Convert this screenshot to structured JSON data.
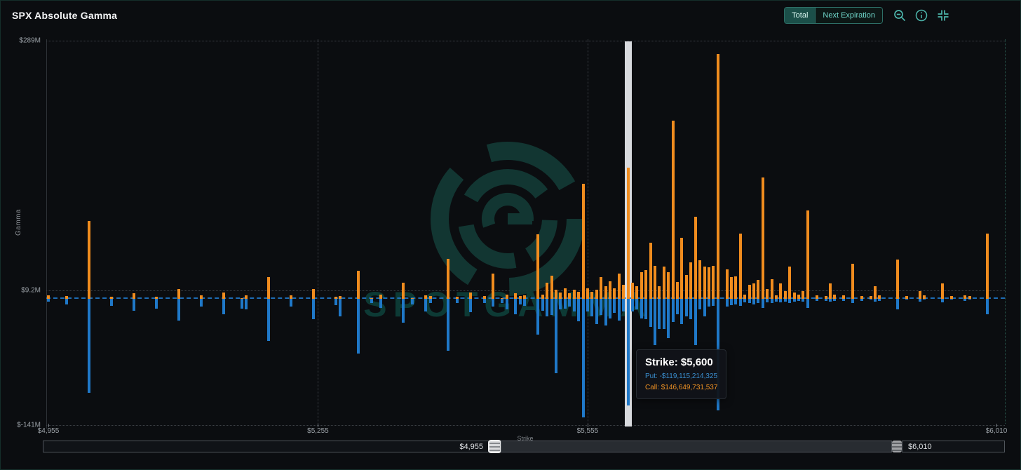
{
  "header": {
    "title": "SPX Absolute Gamma",
    "buttons": [
      {
        "label": "Total",
        "selected": true
      },
      {
        "label": "Next Expiration",
        "selected": false
      }
    ],
    "icons": [
      "zoom-out-icon",
      "info-icon",
      "collapse-icon"
    ],
    "accent_color": "#4db6ac"
  },
  "watermark": {
    "text": "SPOTGAMMA"
  },
  "tooltip": {
    "title": "Strike: $5,600",
    "put": "Put: -$119,115,214,325",
    "call": "Call: $146,649,731,537"
  },
  "slider": {
    "left_value": "$4,955",
    "right_value": "$6,010"
  },
  "chart_data": {
    "type": "bar",
    "title": "SPX Absolute Gamma",
    "xlabel": "Strike",
    "ylabel": "Gamma",
    "grid": "dotted",
    "xlim": [
      4955,
      6010
    ],
    "ylim_m": [
      -141,
      289
    ],
    "x_ticks": [
      {
        "label": "$4,955",
        "value": 4955
      },
      {
        "label": "$5,255",
        "value": 5255
      },
      {
        "label": "$5,555",
        "value": 5555
      },
      {
        "label": "$6,010",
        "value": 6010
      }
    ],
    "y_ticks": [
      {
        "label": "$289M",
        "value_m": 289
      },
      {
        "label": "$9.2M",
        "value_m": 9.2
      },
      {
        "label": "$-141M",
        "value_m": -141
      }
    ],
    "series": [
      {
        "name": "Call",
        "color": "#f08c1e"
      },
      {
        "name": "Put",
        "color": "#1f78c8"
      }
    ],
    "highlighted_strike": 5600,
    "highlight_color": "#d8dade",
    "zero_line_color": "#1f78c8",
    "strikes_format": "[strike, call_gamma_$M, put_gamma_$M]",
    "strikes": [
      [
        4955,
        4,
        -3
      ],
      [
        4975,
        3,
        -6
      ],
      [
        5000,
        87,
        -105
      ],
      [
        5025,
        2,
        -8
      ],
      [
        5050,
        6,
        -13
      ],
      [
        5075,
        2,
        -11
      ],
      [
        5100,
        11,
        -24
      ],
      [
        5125,
        4,
        -9
      ],
      [
        5150,
        7,
        -17
      ],
      [
        5170,
        1,
        -11
      ],
      [
        5175,
        4,
        -12
      ],
      [
        5200,
        24,
        -47
      ],
      [
        5225,
        4,
        -9
      ],
      [
        5250,
        11,
        -23
      ],
      [
        5275,
        2,
        -7
      ],
      [
        5280,
        3,
        -20
      ],
      [
        5300,
        31,
        -61
      ],
      [
        5315,
        1,
        -5
      ],
      [
        5325,
        5,
        -10
      ],
      [
        5350,
        18,
        -27
      ],
      [
        5360,
        1,
        -6
      ],
      [
        5375,
        4,
        -14
      ],
      [
        5380,
        3,
        -5
      ],
      [
        5400,
        45,
        -58
      ],
      [
        5410,
        2,
        -5
      ],
      [
        5425,
        7,
        -15
      ],
      [
        5440,
        3,
        -5
      ],
      [
        5450,
        28,
        -9
      ],
      [
        5460,
        1,
        -5
      ],
      [
        5465,
        5,
        -12
      ],
      [
        5475,
        6,
        -17
      ],
      [
        5480,
        3,
        -6
      ],
      [
        5485,
        4,
        -8
      ],
      [
        5500,
        72,
        -40
      ],
      [
        5505,
        5,
        -13
      ],
      [
        5510,
        18,
        -20
      ],
      [
        5515,
        26,
        -18
      ],
      [
        5520,
        10,
        -83
      ],
      [
        5525,
        7,
        -12
      ],
      [
        5530,
        12,
        -11
      ],
      [
        5535,
        6,
        -9
      ],
      [
        5540,
        10,
        -14
      ],
      [
        5545,
        8,
        -25
      ],
      [
        5550,
        129,
        -133
      ],
      [
        5555,
        12,
        -14
      ],
      [
        5560,
        8,
        -20
      ],
      [
        5565,
        10,
        -28
      ],
      [
        5570,
        24,
        -18
      ],
      [
        5575,
        14,
        -30
      ],
      [
        5580,
        20,
        -22
      ],
      [
        5585,
        12,
        -16
      ],
      [
        5590,
        28,
        -24
      ],
      [
        5595,
        16,
        -14
      ],
      [
        5600,
        146.65,
        -119.12
      ],
      [
        5605,
        18,
        -14
      ],
      [
        5610,
        14,
        -12
      ],
      [
        5615,
        30,
        -22
      ],
      [
        5620,
        32,
        -23
      ],
      [
        5625,
        63,
        -31
      ],
      [
        5630,
        37,
        -52
      ],
      [
        5635,
        14,
        -34
      ],
      [
        5640,
        36,
        -34
      ],
      [
        5645,
        30,
        -44
      ],
      [
        5650,
        199,
        -26
      ],
      [
        5655,
        19,
        -17
      ],
      [
        5660,
        68,
        -28
      ],
      [
        5665,
        27,
        -20
      ],
      [
        5670,
        41,
        -23
      ],
      [
        5675,
        92,
        -52
      ],
      [
        5680,
        43,
        -12
      ],
      [
        5685,
        36,
        -20
      ],
      [
        5690,
        35,
        -9
      ],
      [
        5695,
        37,
        -8
      ],
      [
        5700,
        274,
        -125
      ],
      [
        5710,
        33,
        -9
      ],
      [
        5715,
        24,
        -7
      ],
      [
        5720,
        25,
        -6
      ],
      [
        5725,
        73,
        -8
      ],
      [
        5730,
        5,
        -4
      ],
      [
        5735,
        16,
        -5
      ],
      [
        5740,
        17,
        -6
      ],
      [
        5745,
        21,
        -5
      ],
      [
        5750,
        136,
        -10
      ],
      [
        5755,
        11,
        -4
      ],
      [
        5760,
        22,
        -5
      ],
      [
        5765,
        4,
        -3
      ],
      [
        5770,
        17,
        -4
      ],
      [
        5775,
        9,
        -3
      ],
      [
        5780,
        36,
        -5
      ],
      [
        5785,
        7,
        -3
      ],
      [
        5790,
        5,
        -2
      ],
      [
        5795,
        9,
        -3
      ],
      [
        5800,
        99,
        -10
      ],
      [
        5810,
        4,
        -2
      ],
      [
        5820,
        3,
        -2
      ],
      [
        5825,
        17,
        -3
      ],
      [
        5830,
        5,
        -2
      ],
      [
        5840,
        4,
        -2
      ],
      [
        5850,
        39,
        -5
      ],
      [
        5860,
        3,
        -2
      ],
      [
        5870,
        3,
        -1
      ],
      [
        5875,
        14,
        -3
      ],
      [
        5880,
        4,
        -2
      ],
      [
        5900,
        44,
        -12
      ],
      [
        5910,
        3,
        -1
      ],
      [
        5925,
        9,
        -3
      ],
      [
        5930,
        4,
        -1
      ],
      [
        5950,
        17,
        -4
      ],
      [
        5960,
        3,
        -1
      ],
      [
        5975,
        4,
        -2
      ],
      [
        5980,
        3,
        -1
      ],
      [
        6000,
        73,
        -17
      ]
    ]
  }
}
